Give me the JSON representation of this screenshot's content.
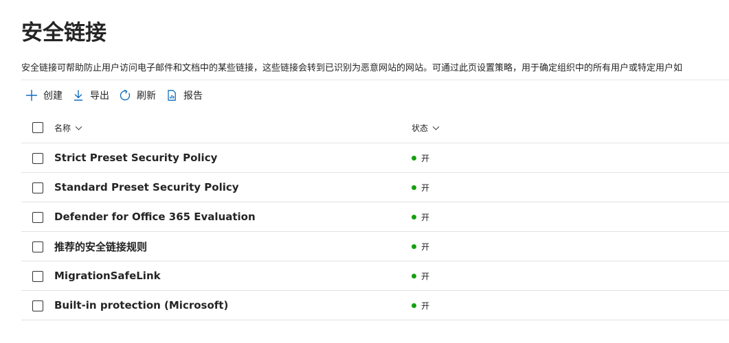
{
  "page": {
    "title": "安全链接",
    "description": "安全链接可帮助防止用户访问电子邮件和文档中的某些链接，这些链接会转到已识别为恶意网站的网站。可通过此页设置策略，用于确定组织中的所有用户或特定用户如"
  },
  "toolbar": {
    "create_label": "创建",
    "export_label": "导出",
    "refresh_label": "刷新",
    "report_label": "报告"
  },
  "table": {
    "headers": {
      "name": "名称",
      "status": "状态"
    },
    "rows": [
      {
        "name": "Strict Preset Security Policy",
        "status": "开"
      },
      {
        "name": "Standard Preset Security Policy",
        "status": "开"
      },
      {
        "name": "Defender for Office 365 Evaluation",
        "status": "开"
      },
      {
        "name": "推荐的安全链接规则",
        "status": "开"
      },
      {
        "name": "MigrationSafeLink",
        "status": "开"
      },
      {
        "name": "Built-in protection (Microsoft)",
        "status": "开"
      }
    ]
  },
  "colors": {
    "accent": "#0f6cbd",
    "status_on": "#13a10e",
    "text": "#242424",
    "divider": "#e1e1e1"
  },
  "icons": {
    "create": "plus-icon",
    "export": "download-icon",
    "refresh": "refresh-icon",
    "report": "report-icon",
    "sort": "chevron-down-icon"
  }
}
